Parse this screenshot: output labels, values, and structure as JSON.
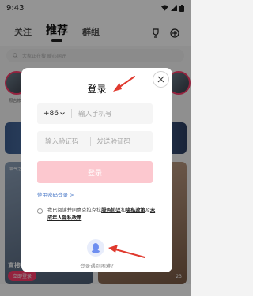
{
  "status_bar": {
    "time": "9:43",
    "icons": [
      "wifi-icon",
      "signal-icon",
      "battery-icon"
    ]
  },
  "top_nav": {
    "tabs": [
      {
        "label": "关注"
      },
      {
        "label": "推荐",
        "active": true
      },
      {
        "label": "群组"
      }
    ],
    "icons": [
      "trophy-icon",
      "add-icon"
    ]
  },
  "search": {
    "placeholder": "大家正在搜 暖心网评"
  },
  "stories": [
    {
      "name": "原吉修仙"
    },
    {
      "name": ""
    },
    {
      "name": ""
    },
    {
      "name": ""
    },
    {
      "name": ""
    },
    {
      "name": ""
    }
  ],
  "cards": [
    {
      "title": "氧气之门",
      "tag": "直接",
      "button": "立即登录",
      "count": ""
    },
    {
      "title": "",
      "tag": "",
      "button": "",
      "count": "23"
    }
  ],
  "dialog": {
    "title": "登录",
    "country_code": "+86",
    "phone_placeholder": "输入手机号",
    "code_placeholder": "输入验证码",
    "send_code": "发送验证码",
    "login_button": "登录",
    "password_login": "使用密码登录 >",
    "agreement": {
      "prefix": "我已阅读并同意克拉克拉",
      "terms": "服务协议",
      "and1": "和",
      "privacy": "隐私政策",
      "and2": "及",
      "minors": "未成年人隐私政策"
    },
    "trouble": "登录遇到困难?",
    "colors": {
      "login_button_bg": "#fcc8cf",
      "link": "#4a79c8",
      "arrow": "#e03a2f"
    }
  }
}
